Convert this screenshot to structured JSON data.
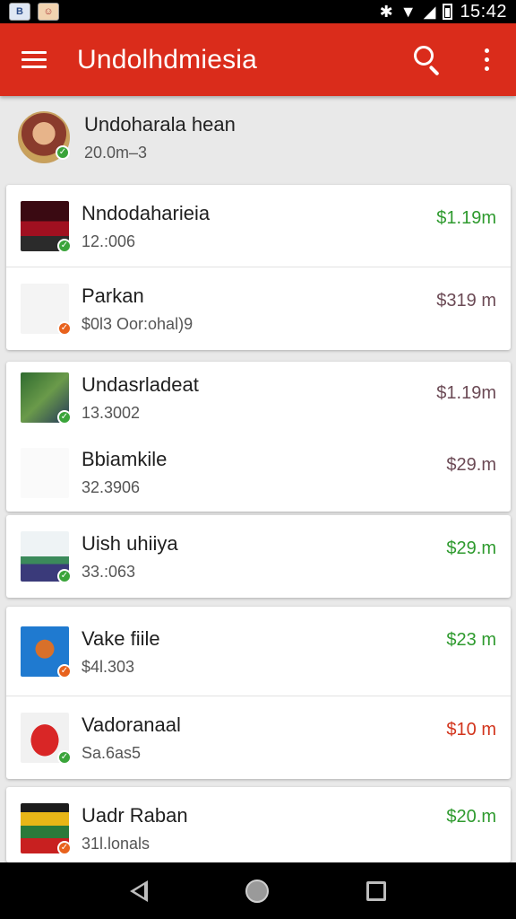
{
  "status_bar": {
    "time": "15:42",
    "thumb_1_label": "B",
    "thumb_2_label": "☺"
  },
  "app_bar": {
    "title": "Undolhdmiesia"
  },
  "profile": {
    "name": "Undoharala hean",
    "subtitle": "20.0m–3"
  },
  "colors": {
    "app_bar": "#da2c1b",
    "price_green": "#2e9a2e",
    "price_gray": "#6b4a55",
    "price_red": "#d2341c",
    "badge_green": "#3aa43a",
    "badge_orange": "#e8621d"
  },
  "items": [
    {
      "title": "Nndodaharieia",
      "subtitle": "12.:006",
      "price": "$1.19m",
      "price_color": "green",
      "badge": "green"
    },
    {
      "title": "Parkan",
      "subtitle": "$0l3 Oor:ohal)9",
      "price": "$319 m",
      "price_color": "gray",
      "badge": "orange"
    },
    {
      "title": "Undasrladeat",
      "subtitle": "13.3002",
      "price": "$1.19m",
      "price_color": "gray",
      "badge": "green"
    },
    {
      "title": "Bbiamkile",
      "subtitle": "32.3906",
      "price": "$29.m",
      "price_color": "gray",
      "badge": "none"
    },
    {
      "title": "Uish uhiiya",
      "subtitle": "33.:063",
      "price": "$29.m",
      "price_color": "green",
      "badge": "green"
    },
    {
      "title": "Vake fiile",
      "subtitle": "$4l.303",
      "price": "$23 m",
      "price_color": "green",
      "badge": "orange"
    },
    {
      "title": "Vadoranaal",
      "subtitle": "Sa.6as5",
      "price": "$10 m",
      "price_color": "red",
      "badge": "green"
    },
    {
      "title": "Uadr Raban",
      "subtitle": "31l.lonals",
      "price": "$20.m",
      "price_color": "green",
      "badge": "orange"
    }
  ]
}
